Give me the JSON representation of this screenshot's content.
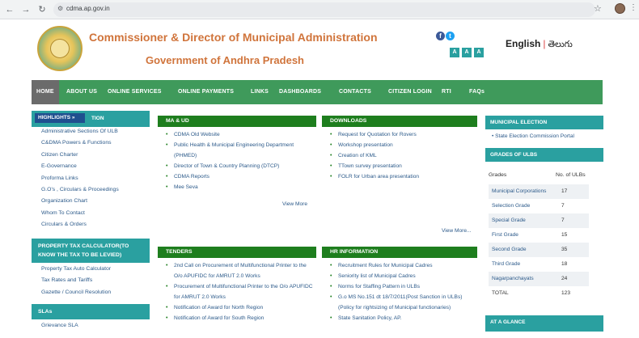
{
  "browser": {
    "url": "cdma.ap.gov.in"
  },
  "header": {
    "title_line1": "Commissioner & Director of Municipal Administration",
    "title_line2": "Government of Andhra Pradesh",
    "font_buttons": [
      "A",
      "A",
      "A"
    ],
    "lang_english": "English",
    "lang_separator": "|",
    "lang_telugu": "తెలుగు"
  },
  "nav": {
    "items": [
      "HOME",
      "ABOUT US",
      "ONLINE SERVICES",
      "ONLINE PAYMENTS",
      "LINKS",
      "DASHBOARDS",
      "CONTACTS",
      "CITIZEN LOGIN",
      "RTI",
      "FAQs"
    ]
  },
  "left": {
    "highlights_tag": "HIGHLIGHTS »",
    "highlights_tail": "TION",
    "links": [
      "Administrative Sections Of ULB",
      "C&DMA Powers & Functions",
      "Citizen Charter",
      "E-Governance",
      "Proforma Links",
      "G.O's , Circulars & Proceedings",
      "Organization Chart",
      "Whom To Contact",
      "Circulars & Orders"
    ],
    "property_tax_head_line1": "PROPERTY TAX CALCULATOR(TO",
    "property_tax_head_line2": "KNOW THE TAX TO BE LEVIED)",
    "property_tax_links": [
      "Property Tax Auto Calculator",
      "Tax Rates and Tariffs",
      "Gazette / Council Resolution"
    ],
    "slas_head": "SLAs",
    "slas_links": [
      "Grievance SLA"
    ]
  },
  "boxes": {
    "maud": {
      "title": "MA & UD",
      "items": [
        [
          "CDMA Old Website"
        ],
        [
          "Public Health & Municipal Engineering Department",
          "(PHMED)"
        ],
        [
          "Director of Town & Country Planning (DTCP)"
        ],
        [
          "CDMA Reports"
        ],
        [
          "Mee Seva"
        ]
      ],
      "view_more": "View More"
    },
    "downloads": {
      "title": "DOWNLOADS",
      "items": [
        "Request for Quotation for Rovers",
        "Workshop presentation",
        "Creation of KML",
        "TTown survey presentation",
        "FOLR for Urban area presentation"
      ],
      "view_more": "View More..."
    },
    "tenders": {
      "title": "TENDERS",
      "items": [
        [
          "2nd Call on Procurement of Multifunctional Printer to the",
          "O/o APUFIDC for AMRUT 2.0 Works"
        ],
        [
          "Procurement of Multifunctional Printer to the O/o APUFIDC",
          "for AMRUT 2.0 Works"
        ],
        [
          "Notification of Award for North Region"
        ],
        [
          "Notification of Award for South Region"
        ]
      ]
    },
    "hr": {
      "title": "HR INFORMATION",
      "items": [
        [
          "Recruitment Rules for Municipal Cadres"
        ],
        [
          "Seniority list of Municipal Cadres"
        ],
        [
          "Norms for Staffing Pattern in ULBs"
        ],
        [
          "G.o MS No.151 dt 18/7/2011(Post Sanction in ULBs)",
          "(Policy for rightsizing of Municipal functionaries)"
        ],
        [
          "State Sanitation Policy, AP."
        ]
      ]
    }
  },
  "right": {
    "election_head": "MUNICIPAL ELECTION",
    "election_link": "State Election Commission Portal",
    "grades_head": "GRADES OF ULBS",
    "grades_col": "Grades",
    "count_col": "No. of ULBs",
    "grades": [
      {
        "grade": "Municipal Corporations",
        "count": "17"
      },
      {
        "grade": "Selection Grade",
        "count": "7"
      },
      {
        "grade": "Special Grade",
        "count": "7"
      },
      {
        "grade": "First Grade",
        "count": "15"
      },
      {
        "grade": "Second Grade",
        "count": "35"
      },
      {
        "grade": "Third Grade",
        "count": "18"
      },
      {
        "grade": "Nagarpanchayats",
        "count": "24"
      },
      {
        "grade": "TOTAL",
        "count": "123"
      }
    ],
    "glance_head": "AT A GLANCE"
  },
  "colors": {
    "accent_orange": "#d0743b",
    "nav_green": "#3f9a5b",
    "teal": "#2aa0a0",
    "box_green": "#1e7e1e",
    "link_blue": "#2c5a8a"
  }
}
